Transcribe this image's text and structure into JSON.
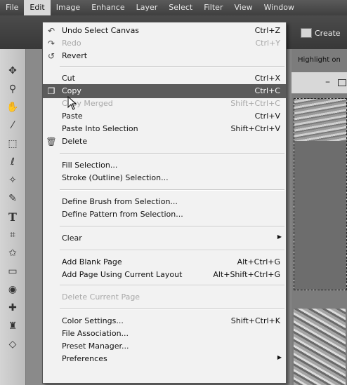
{
  "menubar": {
    "items": [
      "File",
      "Edit",
      "Image",
      "Enhance",
      "Layer",
      "Select",
      "Filter",
      "View",
      "Window"
    ],
    "active": "Edit"
  },
  "optionsbar": {
    "create_label": "Create",
    "highlight_label": "Highlight on"
  },
  "menu": {
    "items": [
      {
        "label": "Undo Select Canvas",
        "shortcut": "Ctrl+Z",
        "icon": "undo-icon",
        "state": "normal"
      },
      {
        "label": "Redo",
        "shortcut": "Ctrl+Y",
        "icon": "redo-icon",
        "state": "disabled"
      },
      {
        "label": "Revert",
        "shortcut": "",
        "icon": "revert-icon",
        "state": "normal"
      },
      {
        "label": "Cut",
        "shortcut": "Ctrl+X",
        "icon": "",
        "state": "normal"
      },
      {
        "label": "Copy",
        "shortcut": "Ctrl+C",
        "icon": "copy-icon",
        "state": "highlighted"
      },
      {
        "label": "Copy Merged",
        "shortcut": "Shift+Ctrl+C",
        "icon": "",
        "state": "disabled"
      },
      {
        "label": "Paste",
        "shortcut": "Ctrl+V",
        "icon": "",
        "state": "normal"
      },
      {
        "label": "Paste Into Selection",
        "shortcut": "Shift+Ctrl+V",
        "icon": "",
        "state": "normal"
      },
      {
        "label": "Delete",
        "shortcut": "",
        "icon": "trash-icon",
        "state": "normal"
      },
      {
        "label": "Fill Selection...",
        "shortcut": "",
        "icon": "",
        "state": "normal"
      },
      {
        "label": "Stroke (Outline) Selection...",
        "shortcut": "",
        "icon": "",
        "state": "normal"
      },
      {
        "label": "Define Brush from Selection...",
        "shortcut": "",
        "icon": "",
        "state": "normal"
      },
      {
        "label": "Define Pattern from Selection...",
        "shortcut": "",
        "icon": "",
        "state": "normal"
      },
      {
        "label": "Clear",
        "shortcut": "",
        "icon": "",
        "state": "submenu"
      },
      {
        "label": "Add Blank Page",
        "shortcut": "Alt+Ctrl+G",
        "icon": "",
        "state": "normal"
      },
      {
        "label": "Add Page Using Current Layout",
        "shortcut": "Alt+Shift+Ctrl+G",
        "icon": "",
        "state": "normal"
      },
      {
        "label": "Delete Current Page",
        "shortcut": "",
        "icon": "",
        "state": "disabled"
      },
      {
        "label": "Color Settings...",
        "shortcut": "Shift+Ctrl+K",
        "icon": "",
        "state": "normal"
      },
      {
        "label": "File Association...",
        "shortcut": "",
        "icon": "",
        "state": "normal"
      },
      {
        "label": "Preset Manager...",
        "shortcut": "",
        "icon": "",
        "state": "normal"
      },
      {
        "label": "Preferences",
        "shortcut": "",
        "icon": "",
        "state": "submenu"
      }
    ]
  },
  "toolbox": {
    "tools": [
      "move-icon",
      "zoom-icon",
      "hand-icon",
      "eyedropper-icon",
      "marquee-icon",
      "lasso-icon",
      "magic-wand-icon",
      "brush-selection-icon",
      "type-icon",
      "crop-icon",
      "cookie-cutter-icon",
      "straighten-icon",
      "red-eye-icon",
      "healing-icon",
      "stamp-icon",
      "eraser-icon"
    ]
  }
}
